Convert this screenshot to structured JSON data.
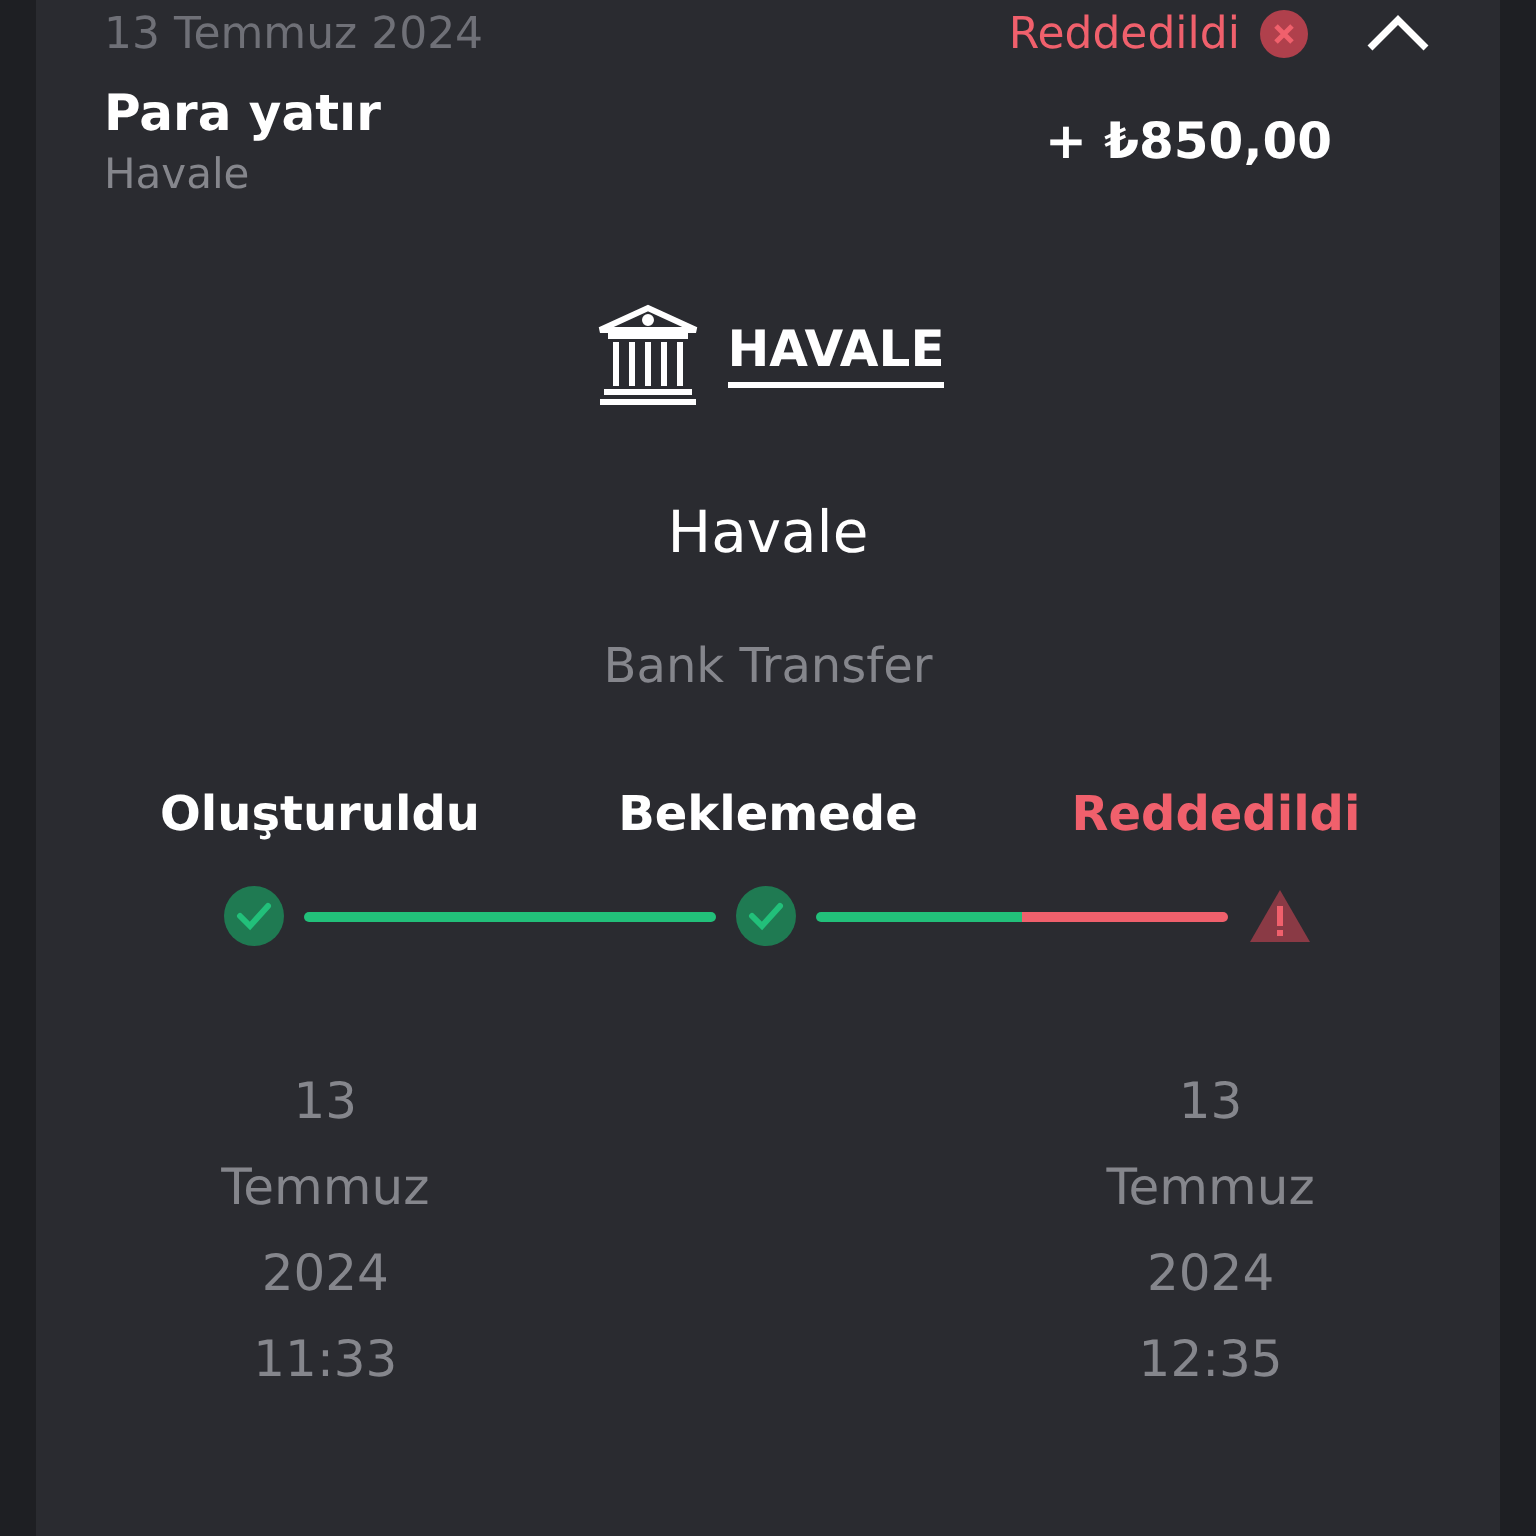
{
  "header": {
    "date": "13 Temmuz 2024",
    "status": "Reddedildi",
    "expanded": true
  },
  "transaction": {
    "title": "Para yatır",
    "method": "Havale",
    "amount": "+ ₺850,00"
  },
  "logo": {
    "text": "HAVALE"
  },
  "method_name": "Havale",
  "method_subtitle": "Bank Transfer",
  "steps": [
    {
      "label": "Oluşturuldu",
      "kind": "done",
      "date": [
        "13",
        "Temmuz",
        "2024",
        "11:33"
      ]
    },
    {
      "label": "Beklemede",
      "kind": "done"
    },
    {
      "label": "Reddedildi",
      "kind": "failed",
      "date": [
        "13",
        "Temmuz",
        "2024",
        "12:35"
      ]
    }
  ]
}
